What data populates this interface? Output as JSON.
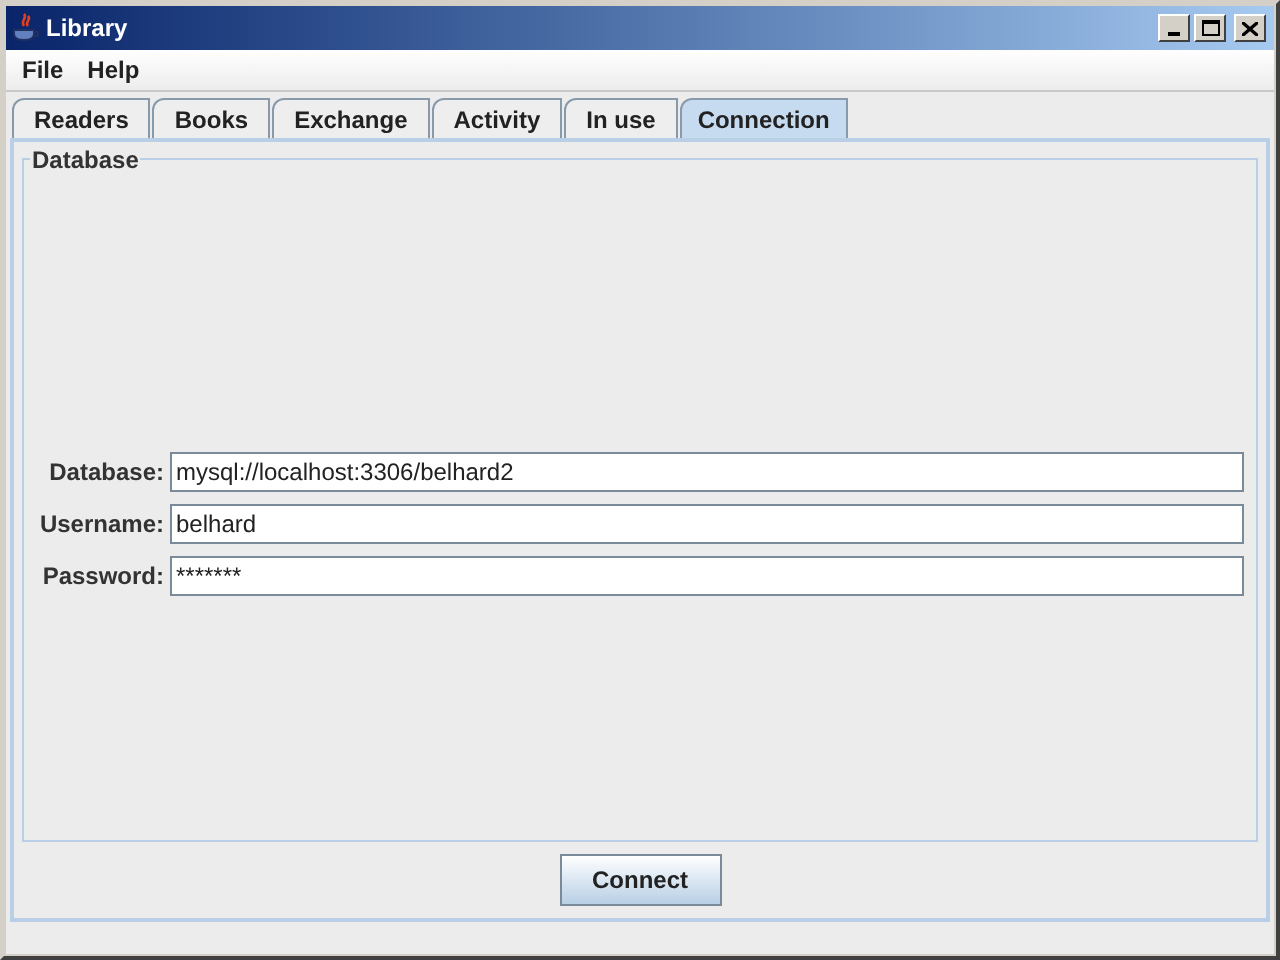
{
  "window": {
    "title": "Library"
  },
  "menu": [
    "File",
    "Help"
  ],
  "tabs": [
    {
      "label": "Readers",
      "selected": false
    },
    {
      "label": "Books",
      "selected": false
    },
    {
      "label": "Exchange",
      "selected": false
    },
    {
      "label": "Activity",
      "selected": false
    },
    {
      "label": "In use",
      "selected": false
    },
    {
      "label": "Connection",
      "selected": true
    }
  ],
  "group": {
    "title": "Database"
  },
  "fields": [
    {
      "label": "Database:",
      "value": "mysql://localhost:3306/belhard2"
    },
    {
      "label": "Username:",
      "value": "belhard"
    },
    {
      "label": "Password:",
      "value": "*******"
    }
  ],
  "button": "Connect"
}
